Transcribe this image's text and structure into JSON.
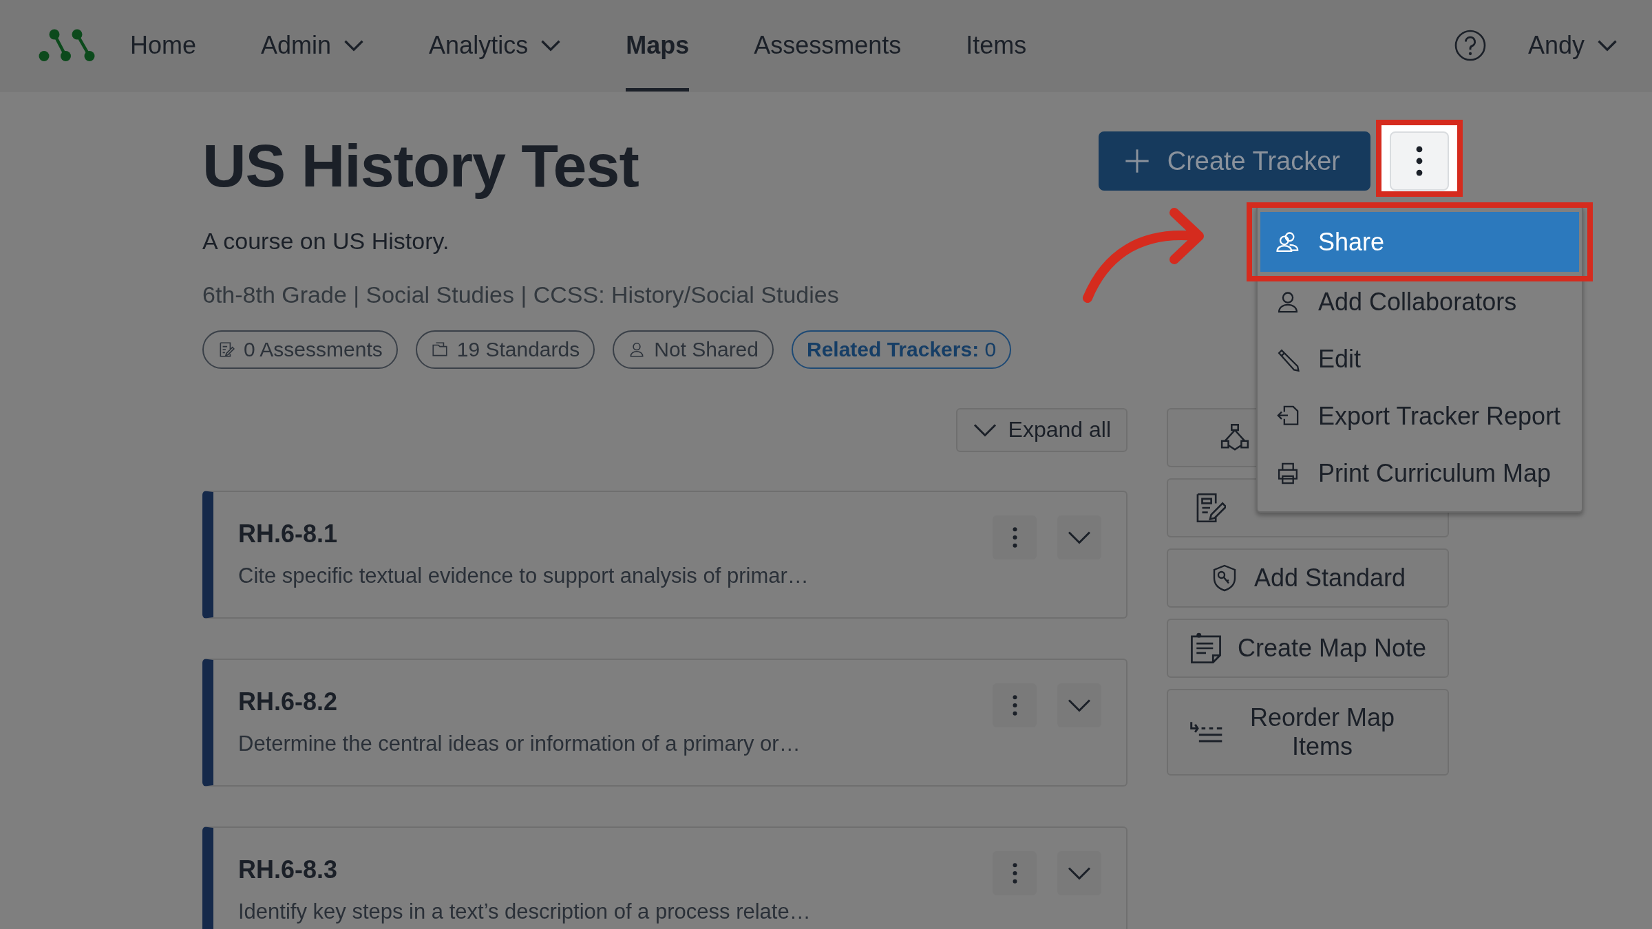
{
  "nav": {
    "items": [
      {
        "label": "Home",
        "selected": false,
        "dropdown": false
      },
      {
        "label": "Admin",
        "selected": false,
        "dropdown": true
      },
      {
        "label": "Analytics",
        "selected": false,
        "dropdown": true
      },
      {
        "label": "Maps",
        "selected": true,
        "dropdown": false
      },
      {
        "label": "Assessments",
        "selected": false,
        "dropdown": false
      },
      {
        "label": "Items",
        "selected": false,
        "dropdown": false
      }
    ],
    "user": "Andy"
  },
  "header": {
    "title": "US History Test",
    "description": "A course on US History.",
    "meta": "6th-8th Grade | Social Studies | CCSS: History/Social Studies",
    "pills": [
      {
        "label": "0 Assessments",
        "kind": "assessments"
      },
      {
        "label": "19 Standards",
        "kind": "standards"
      },
      {
        "label": "Not Shared",
        "kind": "sharing"
      },
      {
        "label": "**Related Trackers:** 0",
        "kind": "link"
      }
    ]
  },
  "create_tracker": "Create Tracker",
  "menu": {
    "items": [
      {
        "label": "Share",
        "selected": true,
        "kind": "share"
      },
      {
        "label": "Add Collaborators",
        "selected": false,
        "kind": "person"
      },
      {
        "label": "Edit",
        "selected": false,
        "kind": "pencil"
      },
      {
        "label": "Export Tracker Report",
        "selected": false,
        "kind": "export"
      },
      {
        "label": "Print Curriculum Map",
        "selected": false,
        "kind": "print"
      }
    ]
  },
  "expand_all": "Expand all",
  "standards": [
    {
      "code": "RH.6-8.1",
      "description": "Cite specific textual evidence to support analysis of primar…"
    },
    {
      "code": "RH.6-8.2",
      "description": "Determine the central ideas or information of a primary or…"
    },
    {
      "code": "RH.6-8.3",
      "description": "Identify key steps in a text’s description of a process relate…"
    }
  ],
  "side_actions": [
    {
      "kind": "network"
    },
    {
      "kind": "assessment"
    },
    {
      "kind": "standard",
      "label": "Add Standard"
    },
    {
      "kind": "note",
      "label": "Create Map Note"
    },
    {
      "kind": "reorder",
      "label": "Reorder Map Items"
    }
  ]
}
